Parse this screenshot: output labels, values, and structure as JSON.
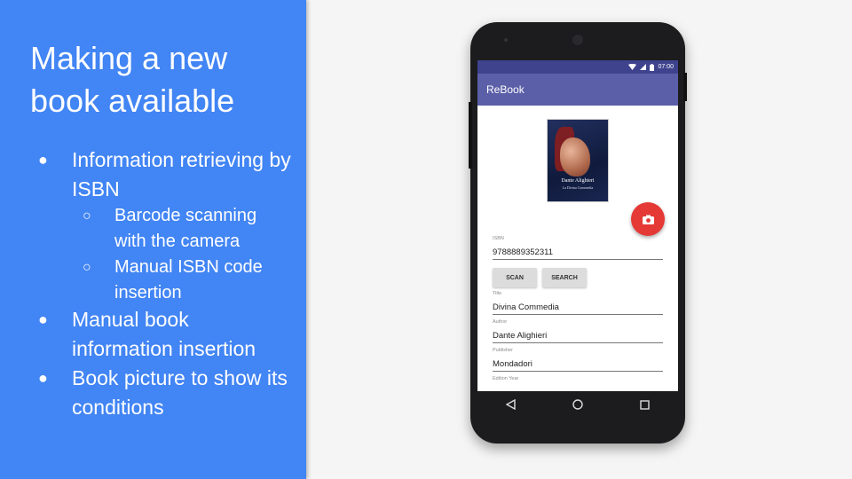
{
  "slide": {
    "title": "Making a new book available",
    "bullets": [
      {
        "text": "Information retrieving by ISBN",
        "sub": [
          "Barcode scanning with the camera",
          "Manual ISBN code insertion"
        ]
      },
      {
        "text": "Manual book information insertion"
      },
      {
        "text": "Book picture to show its conditions"
      }
    ],
    "bullet_glyph": "●",
    "sub_bullet_glyph": "○"
  },
  "phone": {
    "status": {
      "time": "07:00",
      "icons": [
        "wifi-icon",
        "signal-icon",
        "battery-icon"
      ]
    },
    "app": {
      "title": "ReBook",
      "cover": {
        "title": "Dante Alighieri",
        "subtitle": "La Divina Commedia"
      },
      "fab_icon": "camera-icon",
      "fields": {
        "isbn": {
          "label": "ISBN",
          "value": "9788889352311"
        },
        "title": {
          "label": "Title",
          "value": "Divina Commedia"
        },
        "author": {
          "label": "Author",
          "value": "Dante Alighieri"
        },
        "publisher": {
          "label": "Publisher",
          "value": "Mondadori"
        },
        "edition_year": {
          "label": "Edition Year",
          "value": ""
        }
      },
      "buttons": {
        "scan": "SCAN",
        "search": "SEARCH"
      }
    },
    "nav": [
      "back-icon",
      "home-icon",
      "recents-icon"
    ]
  },
  "colors": {
    "panel": "#4285f4",
    "status_bar": "#3f438e",
    "app_bar": "#5b5fa8",
    "fab": "#e53935"
  }
}
